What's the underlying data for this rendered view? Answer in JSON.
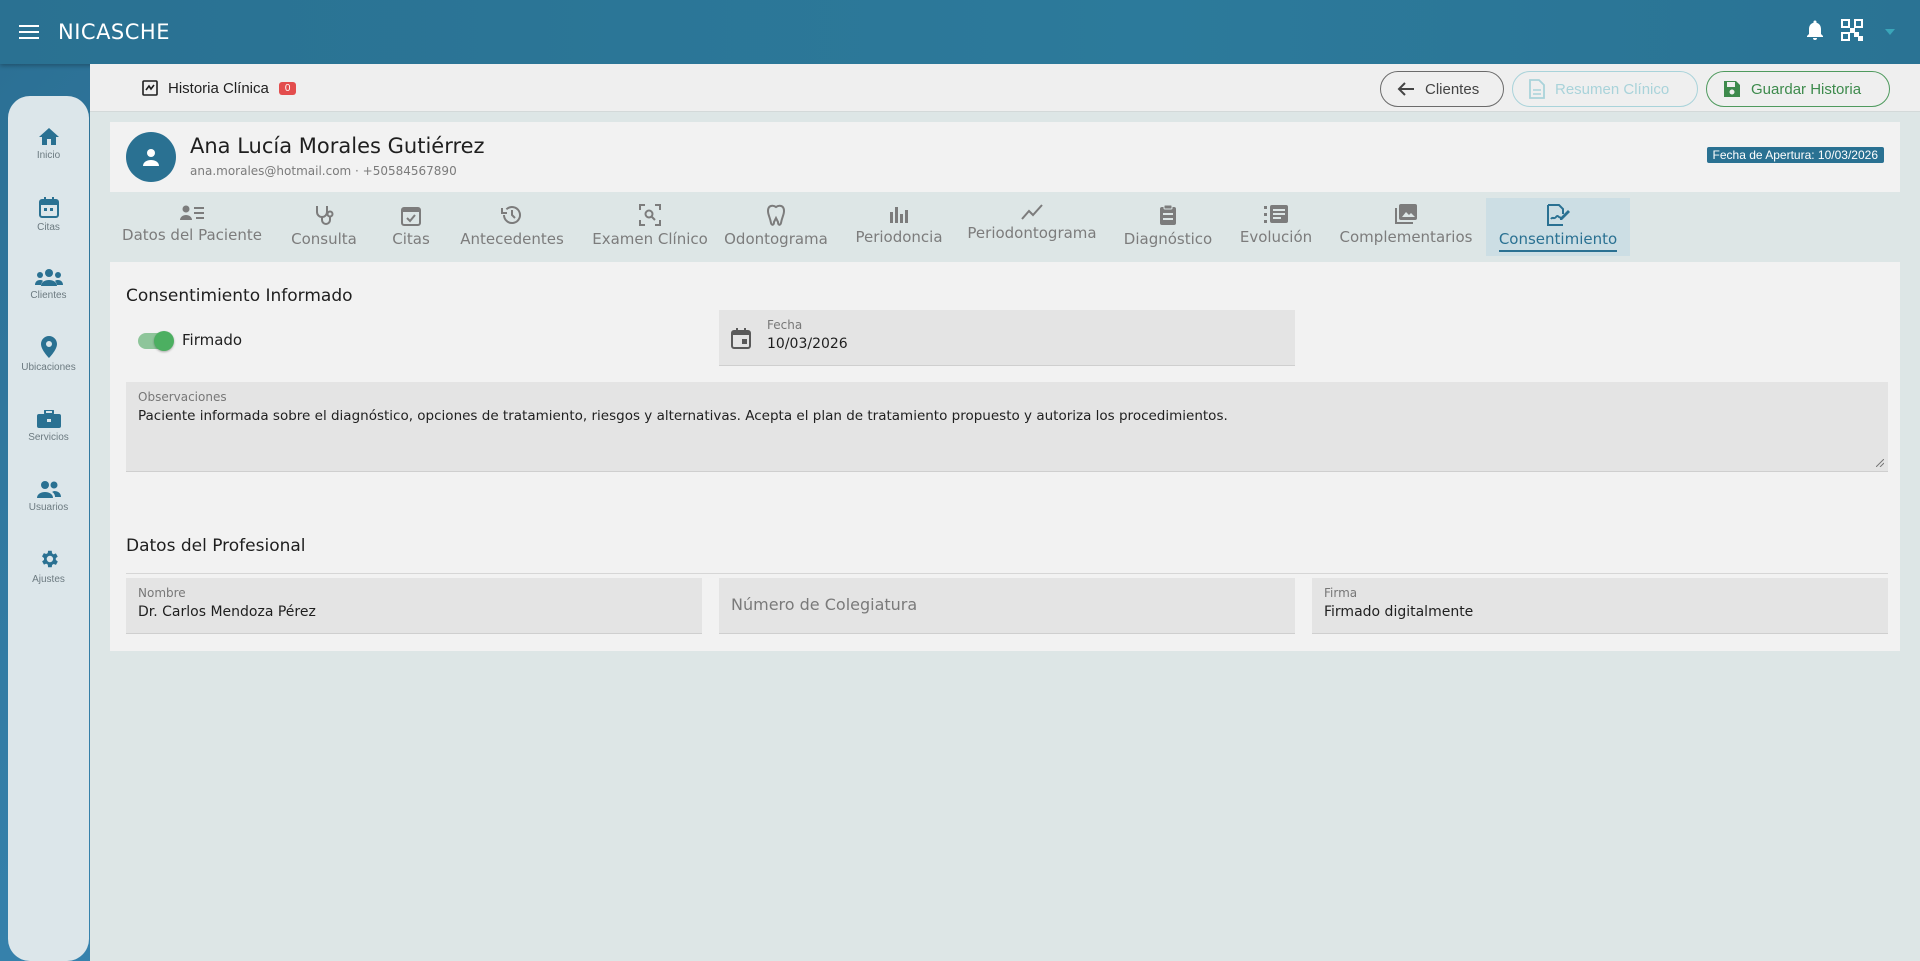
{
  "app": {
    "title": "NICASCHE"
  },
  "rail": [
    {
      "label": "Inicio",
      "icon": "home-icon"
    },
    {
      "label": "Citas",
      "icon": "calendar-icon"
    },
    {
      "label": "Clientes",
      "icon": "group-icon"
    },
    {
      "label": "Ubicaciones",
      "icon": "location-icon"
    },
    {
      "label": "Servicios",
      "icon": "briefcase-icon"
    },
    {
      "label": "Usuarios",
      "icon": "users-icon"
    },
    {
      "label": "Ajustes",
      "icon": "gear-icon"
    }
  ],
  "toolbar": {
    "title": "Historia Clínica",
    "badge": "0",
    "back_label": "Clientes",
    "summary_label": "Resumen Clínico",
    "save_label": "Guardar Historia"
  },
  "patient": {
    "name": "Ana Lucía Morales Gutiérrez",
    "contact": "ana.morales@hotmail.com · +50584567890",
    "opening": "Fecha de Apertura: 10/03/2026"
  },
  "tabs": [
    {
      "label": "Datos del Paciente",
      "icon": "patient-list-icon"
    },
    {
      "label": "Consulta",
      "icon": "stethoscope-icon"
    },
    {
      "label": "Citas",
      "icon": "calendar-check-icon"
    },
    {
      "label": "Antecedentes",
      "icon": "history-icon"
    },
    {
      "label": "Examen Clínico",
      "icon": "scan-icon"
    },
    {
      "label": "Odontograma",
      "icon": "tooth-icon"
    },
    {
      "label": "Periodoncia",
      "icon": "bar-chart-icon"
    },
    {
      "label": "Periodontograma",
      "icon": "trend-icon"
    },
    {
      "label": "Diagnóstico",
      "icon": "clipboard-icon"
    },
    {
      "label": "Evolución",
      "icon": "list-numbered-icon"
    },
    {
      "label": "Complementarios",
      "icon": "images-icon"
    },
    {
      "label": "Consentimiento",
      "icon": "signature-icon"
    }
  ],
  "consent": {
    "title": "Consentimiento Informado",
    "signed_label": "Firmado",
    "signed": true,
    "date_label": "Fecha",
    "date_value": "10/03/2026",
    "obs_label": "Observaciones",
    "obs_value": "Paciente informada sobre el diagnóstico, opciones de tratamiento, riesgos y alternativas. Acepta el plan de tratamiento propuesto y autoriza los procedimientos."
  },
  "professional": {
    "title": "Datos del Profesional",
    "name_label": "Nombre",
    "name_value": "Dr. Carlos Mendoza Pérez",
    "license_placeholder": "Número de Colegiatura",
    "signature_label": "Firma",
    "signature_value": "Firmado digitalmente"
  },
  "colors": {
    "primary": "#2a7192",
    "success": "#4caf61",
    "danger": "#e34d4d"
  }
}
